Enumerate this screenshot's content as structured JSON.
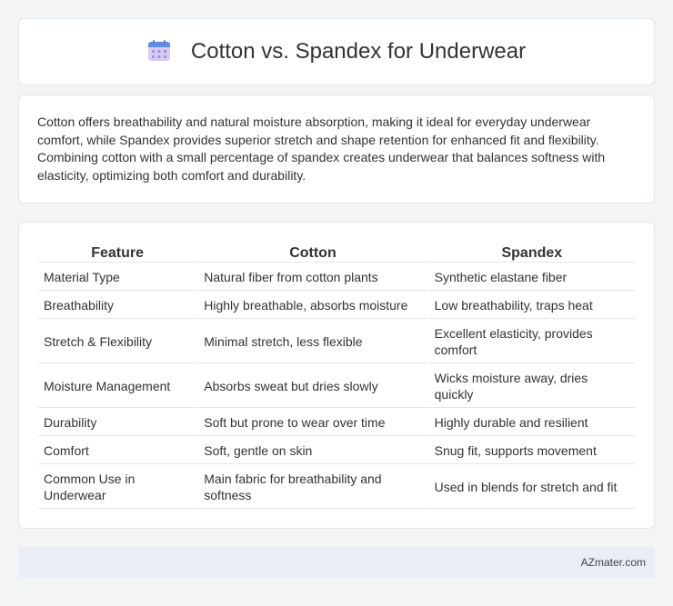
{
  "header": {
    "title": "Cotton vs. Spandex for Underwear",
    "icon": "calendar-icon"
  },
  "summary": {
    "text": "Cotton offers breathability and natural moisture absorption, making it ideal for everyday underwear comfort, while Spandex provides superior stretch and shape retention for enhanced fit and flexibility. Combining cotton with a small percentage of spandex creates underwear that balances softness with elasticity, optimizing both comfort and durability."
  },
  "table": {
    "headers": [
      "Feature",
      "Cotton",
      "Spandex"
    ],
    "rows": [
      [
        "Material Type",
        "Natural fiber from cotton plants",
        "Synthetic elastane fiber"
      ],
      [
        "Breathability",
        "Highly breathable, absorbs moisture",
        "Low breathability, traps heat"
      ],
      [
        "Stretch & Flexibility",
        "Minimal stretch, less flexible",
        "Excellent elasticity, provides comfort"
      ],
      [
        "Moisture Management",
        "Absorbs sweat but dries slowly",
        "Wicks moisture away, dries quickly"
      ],
      [
        "Durability",
        "Soft but prone to wear over time",
        "Highly durable and resilient"
      ],
      [
        "Comfort",
        "Soft, gentle on skin",
        "Snug fit, supports movement"
      ],
      [
        "Common Use in Underwear",
        "Main fabric for breathability and softness",
        "Used in blends for stretch and fit"
      ]
    ]
  },
  "footer": {
    "text": "AZmater.com"
  },
  "colors": {
    "icon_top": "#5b8def",
    "icon_body": "#c9b8f0",
    "footer_bg": "#e9edf6"
  }
}
